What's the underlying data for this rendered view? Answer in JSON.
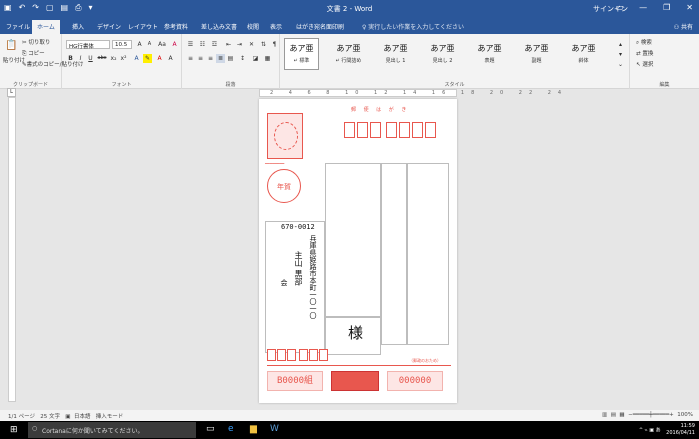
{
  "window": {
    "title": "文書 2 - Word",
    "signin": "サインイン",
    "qat_icons": [
      "save-icon",
      "undo-icon",
      "redo-icon",
      "new-doc-icon",
      "open-icon",
      "print-preview-icon",
      "customize-icon"
    ]
  },
  "tabs": [
    "ファイル",
    "ホーム",
    "挿入",
    "デザイン",
    "レイアウト",
    "参考資料",
    "差し込み文書",
    "校閲",
    "表示",
    "はがき宛名面印刷"
  ],
  "active_tab": "ホーム",
  "tell_me": "♀ 実行したい作業を入力してください",
  "share": "共有",
  "ribbon": {
    "clipboard": {
      "paste": "貼り付け",
      "cut": "切り取り",
      "copy": "コピー",
      "format_painter": "書式のコピー/貼り付け",
      "label": "クリップボード"
    },
    "font": {
      "name": "HG行書体",
      "size": "10.5",
      "grow": "A",
      "shrink": "A",
      "case": "Aa",
      "clear": "A",
      "buttons": [
        "B",
        "I",
        "U",
        "abc",
        "x₂",
        "x²",
        "A",
        "A",
        "A"
      ],
      "label": "フォント"
    },
    "paragraph": {
      "label": "段落"
    },
    "styles": {
      "items": [
        {
          "sample": "あア亜",
          "name": "↵ 標準"
        },
        {
          "sample": "あア亜",
          "name": "↵ 行間詰め"
        },
        {
          "sample": "あア亜",
          "name": "見出し 1"
        },
        {
          "sample": "あア亜",
          "name": "見出し 2"
        },
        {
          "sample": "あア亜",
          "name": "表題"
        },
        {
          "sample": "あア亜",
          "name": "副題"
        },
        {
          "sample": "あア亜",
          "name": "斜体"
        }
      ],
      "label": "スタイル"
    },
    "editing": {
      "find": "検索",
      "replace": "置換",
      "select": "選択",
      "label": "編集"
    }
  },
  "ruler": {
    "ticks": "2 4 6 8 10 12 14 16 18 20 22 24"
  },
  "postcard": {
    "header": "郵 便 は が き",
    "postal_code": "670-0012",
    "address": "兵庫県姫路市本町一〇一〇",
    "recipient": "主山 黒部",
    "company": "会",
    "honorific": "様",
    "lottery_group": "B0000組",
    "lottery_number": "000000",
    "stamp_caption": "年賀",
    "footer_note": "（郵政のおため）"
  },
  "status": {
    "page": "1/1 ページ",
    "words": "25 文字",
    "lang": "日本語",
    "mode": "挿入モード",
    "zoom": "100%"
  },
  "taskbar": {
    "cortana": "Cortanaに何か聞いてみてください。",
    "time": "11:59",
    "date": "2016/04/11",
    "ime": "あ"
  }
}
